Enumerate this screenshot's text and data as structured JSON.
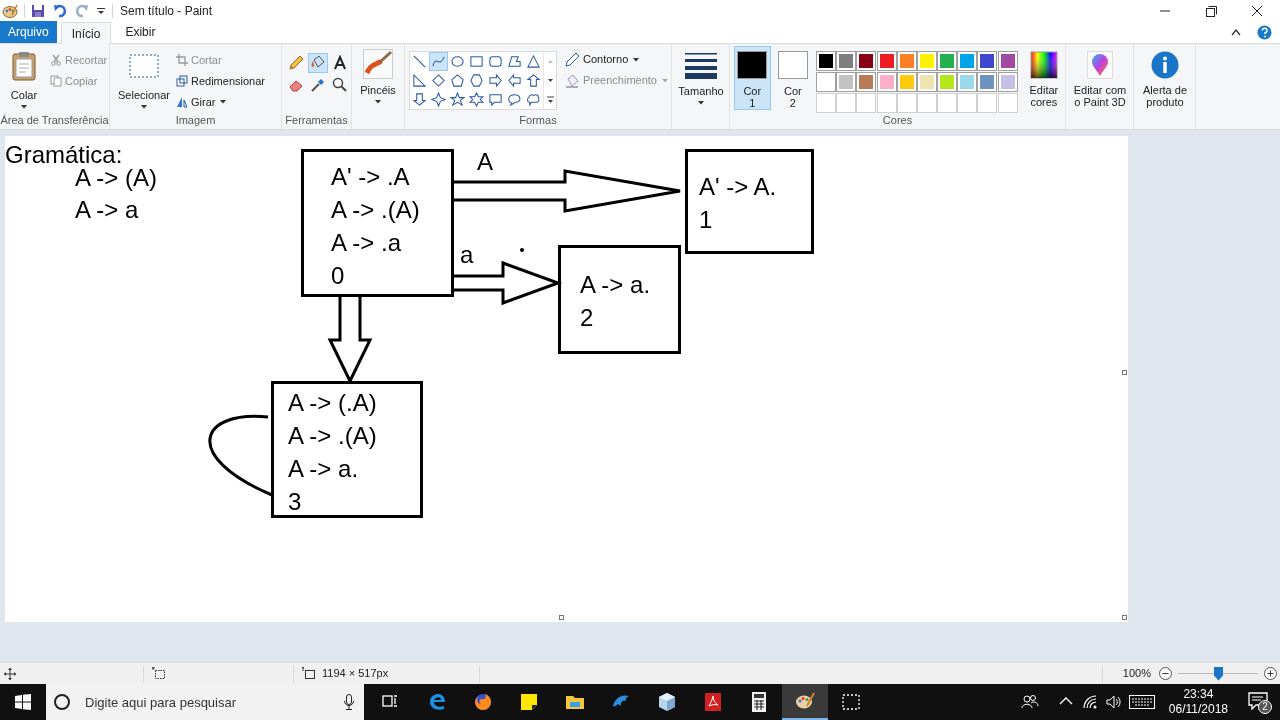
{
  "window": {
    "title": "Sem título - Paint"
  },
  "tabs": [
    {
      "label": "Arquivo",
      "kind": "file",
      "selected": false
    },
    {
      "label": "Início",
      "kind": "tab",
      "selected": true
    },
    {
      "label": "Exibir",
      "kind": "tab",
      "selected": false
    }
  ],
  "ribbon": {
    "clipboard": {
      "label": "Área de Transferência",
      "paste": "Colar",
      "actions": [
        {
          "label": "Recortar",
          "kind": "cut",
          "disabled": true
        },
        {
          "label": "Copiar",
          "kind": "copy",
          "disabled": true
        }
      ]
    },
    "image": {
      "label": "Imagem",
      "select": "Selecionar",
      "actions": [
        {
          "label": "Cortar",
          "kind": "crop",
          "disabled": true,
          "dropdown": false
        },
        {
          "label": "Redimensionar",
          "kind": "resize",
          "disabled": false,
          "dropdown": false
        },
        {
          "label": "Girar",
          "kind": "rotate",
          "disabled": false,
          "dropdown": true
        }
      ]
    },
    "tools": {
      "label": "Ferramentas",
      "items": [
        {
          "kind": "pencil",
          "selected": false
        },
        {
          "kind": "fill",
          "selected": true
        },
        {
          "kind": "text",
          "selected": false
        },
        {
          "kind": "eraser",
          "selected": false
        },
        {
          "kind": "picker",
          "selected": false
        },
        {
          "kind": "magnifier",
          "selected": false
        }
      ]
    },
    "brushes": {
      "label": "Pincéis"
    },
    "shapes": {
      "label": "Formas",
      "items": [
        {
          "kind": "line",
          "selected": false
        },
        {
          "kind": "curve",
          "selected": true
        },
        {
          "kind": "oval",
          "selected": false
        },
        {
          "kind": "rect",
          "selected": false
        },
        {
          "kind": "roundrect",
          "selected": false
        },
        {
          "kind": "polygon",
          "selected": false
        },
        {
          "kind": "triangle",
          "selected": false
        },
        {
          "kind": "right-triangle",
          "selected": false
        },
        {
          "kind": "diamond",
          "selected": false
        },
        {
          "kind": "pentagon",
          "selected": false
        },
        {
          "kind": "hexagon",
          "selected": false
        },
        {
          "kind": "arrow-right",
          "selected": false
        },
        {
          "kind": "arrow-left",
          "selected": false
        },
        {
          "kind": "arrow-up",
          "selected": false
        },
        {
          "kind": "arrow-down",
          "selected": false
        },
        {
          "kind": "star4",
          "selected": false
        },
        {
          "kind": "star5",
          "selected": false
        },
        {
          "kind": "star6",
          "selected": false
        },
        {
          "kind": "callout-rect",
          "selected": false
        },
        {
          "kind": "callout-oval",
          "selected": false
        },
        {
          "kind": "callout-cloud",
          "selected": false
        }
      ],
      "outline": {
        "label": "Contorno",
        "disabled": false
      },
      "fill": {
        "label": "Preenchimento",
        "disabled": true
      }
    },
    "size": {
      "label": "Tamanho"
    },
    "colors": {
      "label": "Cores",
      "color1": {
        "label": "Cor",
        "number": "1",
        "selected": true,
        "color": "#000000"
      },
      "color2": {
        "label": "Cor",
        "number": "2",
        "selected": false,
        "color": "#ffffff"
      },
      "palette": [
        {
          "color": "#000000"
        },
        {
          "color": "#7f7f7f"
        },
        {
          "color": "#880015"
        },
        {
          "color": "#ed1c24"
        },
        {
          "color": "#ff7f27"
        },
        {
          "color": "#fff200"
        },
        {
          "color": "#22b14c"
        },
        {
          "color": "#00a2e8"
        },
        {
          "color": "#3f48cc"
        },
        {
          "color": "#a349a4"
        },
        {
          "color": "#ffffff"
        },
        {
          "color": "#c3c3c3"
        },
        {
          "color": "#b97a57"
        },
        {
          "color": "#ffaec9"
        },
        {
          "color": "#ffc90e"
        },
        {
          "color": "#efe4b0"
        },
        {
          "color": "#b5e61d"
        },
        {
          "color": "#99d9ea"
        },
        {
          "color": "#7092be"
        },
        {
          "color": "#c8bfe7"
        }
      ],
      "edit": [
        "Editar",
        "cores"
      ]
    },
    "paint3d": [
      "Editar com",
      "o Paint 3D"
    ],
    "alert": [
      "Alerta de",
      "produto"
    ]
  },
  "canvas": {
    "grammar": {
      "title": "Gramática:",
      "rules": [
        "A -> (A)",
        "A -> a"
      ]
    },
    "states": [
      {
        "items": [
          "A' -> .A",
          "A -> .(A)",
          "A -> .a"
        ],
        "number": "0"
      },
      {
        "items": [
          "A' -> A."
        ],
        "number": "1"
      },
      {
        "items": [
          "A -> a."
        ],
        "number": "2"
      },
      {
        "items": [
          "A -> (.A)",
          "A -> .(A)",
          "A -> a."
        ],
        "number": "3"
      }
    ],
    "edges": [
      {
        "kind": "arrow-right",
        "label": "A"
      },
      {
        "kind": "arrow-right",
        "label": "a"
      },
      {
        "kind": "arrow-down"
      },
      {
        "kind": "loop"
      }
    ]
  },
  "status_bar": {
    "dimensions": "1194 × 517px",
    "zoom": "100%",
    "zoom_slider": {
      "level": 0.5
    }
  },
  "taskbar": {
    "search": {
      "placeholder": "Digite aqui para pesquisar"
    },
    "apps": [
      {
        "kind": "task-view",
        "active": false
      },
      {
        "kind": "edge",
        "active": false
      },
      {
        "kind": "firefox",
        "active": false
      },
      {
        "kind": "sticky",
        "active": false
      },
      {
        "kind": "folder",
        "active": false
      },
      {
        "kind": "dolphin",
        "active": false
      },
      {
        "kind": "cube",
        "active": false
      },
      {
        "kind": "pdf",
        "active": false
      },
      {
        "kind": "calculator",
        "active": false
      },
      {
        "kind": "paint",
        "active": true
      },
      {
        "kind": "snip",
        "active": false
      }
    ],
    "time": "23:34",
    "date": "06/11/2018",
    "notifications": "2"
  }
}
